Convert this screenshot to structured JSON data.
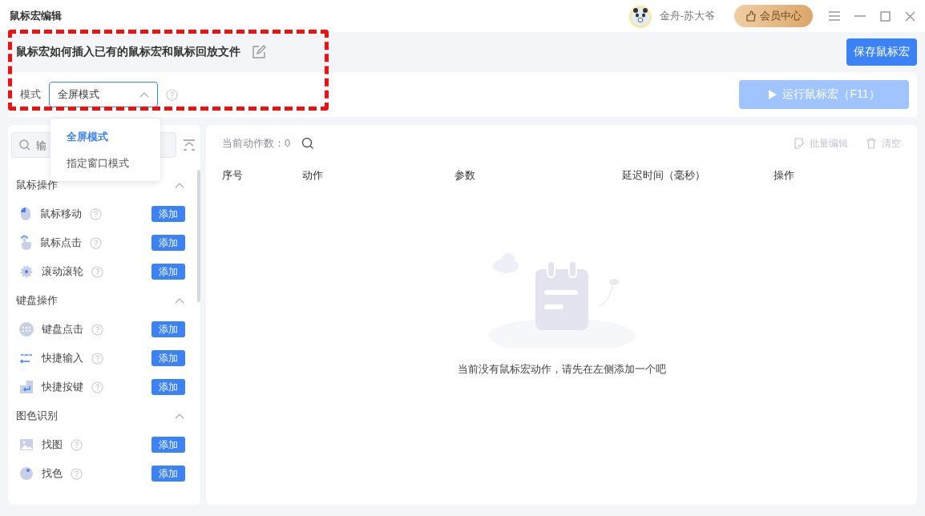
{
  "window": {
    "title": "鼠标宏编辑",
    "user": "金舟-苏大爷",
    "member_button": "会员中心"
  },
  "header": {
    "macro_title": "鼠标宏如何插入已有的鼠标宏和鼠标回放文件",
    "save_button": "保存鼠标宏"
  },
  "mode_bar": {
    "label": "模式",
    "select_value": "全屏模式",
    "expanded": true,
    "run_button": {
      "label": "运行鼠标宏（F11）",
      "disabled": true
    }
  },
  "mode_dropdown": [
    {
      "label": "全屏模式",
      "selected": true
    },
    {
      "label": "指定窗口模式",
      "selected": false
    }
  ],
  "sidebar": {
    "search": {
      "placeholder": "输"
    },
    "sections": [
      {
        "title": "鼠标操作",
        "expanded": true,
        "items": [
          {
            "kind": "mouse",
            "label": "鼠标移动",
            "button": "添加"
          },
          {
            "kind": "click",
            "label": "鼠标点击",
            "button": "添加"
          },
          {
            "kind": "wheel",
            "label": "滚动滚轮",
            "button": "添加"
          }
        ]
      },
      {
        "title": "键盘操作",
        "expanded": true,
        "items": [
          {
            "kind": "keyboard",
            "label": "键盘点击",
            "button": "添加"
          },
          {
            "kind": "input",
            "label": "快捷输入",
            "button": "添加"
          },
          {
            "kind": "hotkey",
            "label": "快捷按键",
            "button": "添加"
          }
        ]
      },
      {
        "title": "图色识别",
        "expanded": true,
        "items": [
          {
            "kind": "image",
            "label": "找图",
            "button": "添加"
          },
          {
            "kind": "color",
            "label": "找色",
            "button": "添加"
          }
        ]
      }
    ]
  },
  "actions_panel": {
    "count_label": "当前动作数：0",
    "toolbar": [
      {
        "kind": "edit",
        "label": "批量编辑",
        "disabled": true
      },
      {
        "kind": "clear",
        "label": "清空",
        "disabled": true
      }
    ],
    "columns": [
      "序号",
      "动作",
      "参数",
      "延迟时间（毫秒）",
      "操作"
    ],
    "empty_message": "当前没有鼠标宏动作，请先在左侧添加一个吧"
  }
}
